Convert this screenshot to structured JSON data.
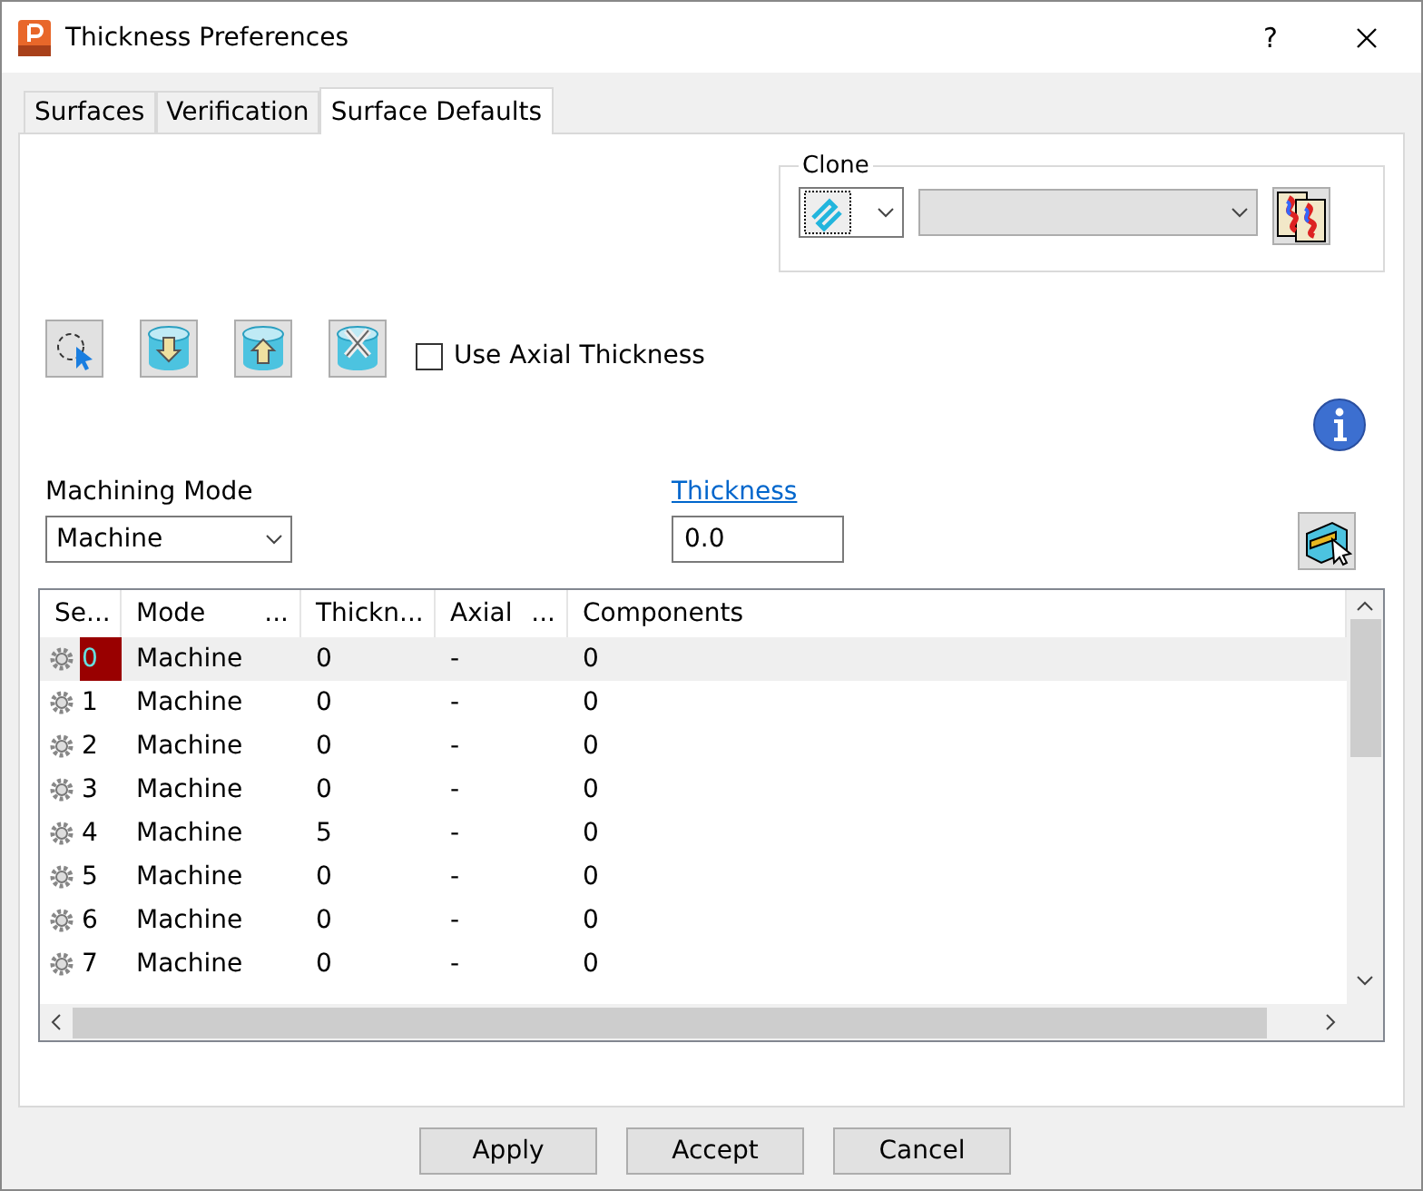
{
  "window": {
    "title": "Thickness Preferences",
    "help": "?"
  },
  "tabs": [
    {
      "label": "Surfaces",
      "selected": false
    },
    {
      "label": "Verification",
      "selected": false
    },
    {
      "label": "Surface Defaults",
      "selected": true
    }
  ],
  "clone": {
    "label": "Clone"
  },
  "use_axial_thickness": {
    "label": "Use Axial Thickness",
    "checked": false
  },
  "machining_mode": {
    "label": "Machining Mode",
    "value": "Machine"
  },
  "thickness": {
    "label": "Thickness",
    "value": "0.0"
  },
  "table": {
    "columns": [
      {
        "label": "Se..."
      },
      {
        "label": "Mode",
        "more": "..."
      },
      {
        "label": "Thickn..."
      },
      {
        "label": "Axial",
        "more": "..."
      },
      {
        "label": "Components"
      }
    ],
    "rows": [
      {
        "set": "0",
        "mode": "Machine",
        "thickness": "0",
        "axial": "-",
        "components": "0",
        "selected": true
      },
      {
        "set": "1",
        "mode": "Machine",
        "thickness": "0",
        "axial": "-",
        "components": "0",
        "selected": false
      },
      {
        "set": "2",
        "mode": "Machine",
        "thickness": "0",
        "axial": "-",
        "components": "0",
        "selected": false
      },
      {
        "set": "3",
        "mode": "Machine",
        "thickness": "0",
        "axial": "-",
        "components": "0",
        "selected": false
      },
      {
        "set": "4",
        "mode": "Machine",
        "thickness": "5",
        "axial": "-",
        "components": "0",
        "selected": false
      },
      {
        "set": "5",
        "mode": "Machine",
        "thickness": "0",
        "axial": "-",
        "components": "0",
        "selected": false
      },
      {
        "set": "6",
        "mode": "Machine",
        "thickness": "0",
        "axial": "-",
        "components": "0",
        "selected": false
      },
      {
        "set": "7",
        "mode": "Machine",
        "thickness": "0",
        "axial": "-",
        "components": "0",
        "selected": false
      }
    ]
  },
  "buttons": [
    "Apply",
    "Accept",
    "Cancel"
  ]
}
